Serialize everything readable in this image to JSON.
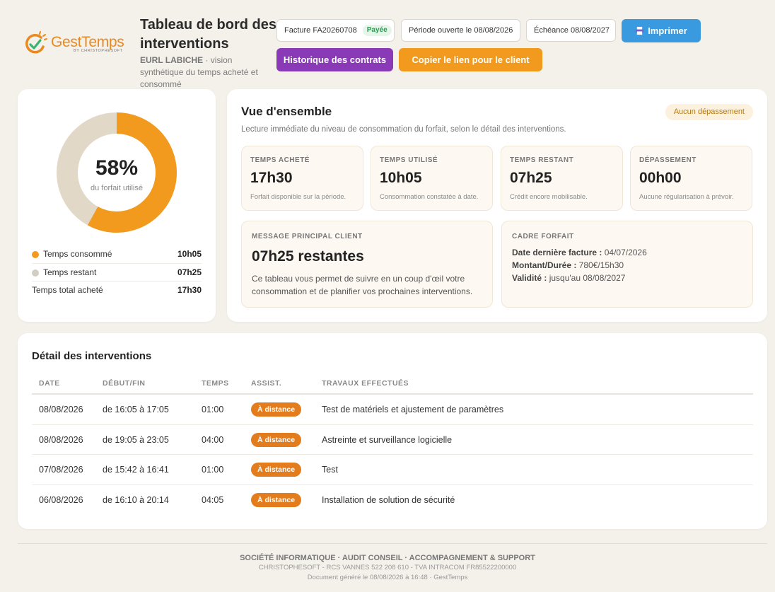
{
  "brand": {
    "name_part1": "Gest",
    "name_part2": "Temps",
    "tagline": "BY CHRISTOPHESOFT",
    "accent_orange": "#f29a1e",
    "accent_blue": "#3a9ae0",
    "accent_purple": "#8a3ab6",
    "logo_icon": "gesttemps-logo-icon"
  },
  "header": {
    "title": "Tableau de bord des interventions",
    "client": "EURL LABICHE",
    "subtitle": " · vision synthétique du temps acheté et consommé",
    "invoice": "Facture FA20260708",
    "invoice_status": "Payée",
    "period": "Période ouverte le 08/08/2026",
    "due": "Échéance 08/08/2027",
    "print_label": "Imprimer",
    "print_icon": "printer-icon",
    "history_label": "Historique des contrats",
    "copy_label": "Copier le lien pour le client"
  },
  "usage": {
    "percent_used": 58,
    "percent_label": "58%",
    "caption": "du forfait utilisé",
    "color_used": "#f29a1e",
    "color_remaining": "#e2d8c7",
    "legend": {
      "consumed_label": "Temps consommé",
      "consumed_value": "10h05",
      "remaining_label": "Temps restant",
      "remaining_value": "07h25",
      "total_label": "Temps total acheté",
      "total_value": "17h30"
    }
  },
  "overview": {
    "title": "Vue d'ensemble",
    "subtitle": "Lecture immédiate du niveau de consommation du forfait, selon le détail des interventions.",
    "badge": "Aucun dépassement",
    "stats": [
      {
        "label": "TEMPS ACHETÉ",
        "value": "17h30",
        "note": "Forfait disponible sur la période."
      },
      {
        "label": "TEMPS UTILISÉ",
        "value": "10h05",
        "note": "Consommation constatée à date."
      },
      {
        "label": "TEMPS RESTANT",
        "value": "07h25",
        "note": "Crédit encore mobilisable."
      },
      {
        "label": "DÉPASSEMENT",
        "value": "00h00",
        "note": "Aucune régularisation à prévoir."
      }
    ],
    "message": {
      "label": "MESSAGE PRINCIPAL CLIENT",
      "value": "07h25 restantes",
      "text": "Ce tableau vous permet de suivre en un coup d'œil votre consommation et de planifier vos prochaines interventions."
    },
    "frame": {
      "label": "CADRE FORFAIT",
      "line1_key": "Date dernière facture :",
      "line1_val": " 04/07/2026",
      "line2_key": "Montant/Durée :",
      "line2_val": " 780€/15h30",
      "line3_key": "Validité :",
      "line3_val": " jusqu'au 08/08/2027"
    }
  },
  "detail": {
    "title": "Détail des interventions",
    "columns": [
      "DATE",
      "DÉBUT/FIN",
      "TEMPS",
      "ASSIST.",
      "TRAVAUX EFFECTUÉS"
    ],
    "rows": [
      {
        "date": "08/08/2026",
        "span": "de 16:05 à 17:05",
        "time": "01:00",
        "assist": "À distance",
        "work": "Test de matériels et ajustement de paramètres"
      },
      {
        "date": "08/08/2026",
        "span": "de 19:05 à 23:05",
        "time": "04:00",
        "assist": "À distance",
        "work": "Astreinte et surveillance logicielle"
      },
      {
        "date": "07/08/2026",
        "span": "de 15:42 à 16:41",
        "time": "01:00",
        "assist": "À distance",
        "work": "Test"
      },
      {
        "date": "06/08/2026",
        "span": "de 16:10 à 20:14",
        "time": "04:05",
        "assist": "À distance",
        "work": "Installation de solution de sécurité"
      }
    ]
  },
  "footer": {
    "line1": "SOCIÉTÉ INFORMATIQUE · AUDIT CONSEIL · ACCOMPAGNEMENT & SUPPORT",
    "line2": "CHRISTOPHESOFT - RCS VANNES 522 208 610 - TVA INTRACOM FR85522200000",
    "line3": "Document généré le 08/08/2026 à 16:48 · GestTemps"
  }
}
